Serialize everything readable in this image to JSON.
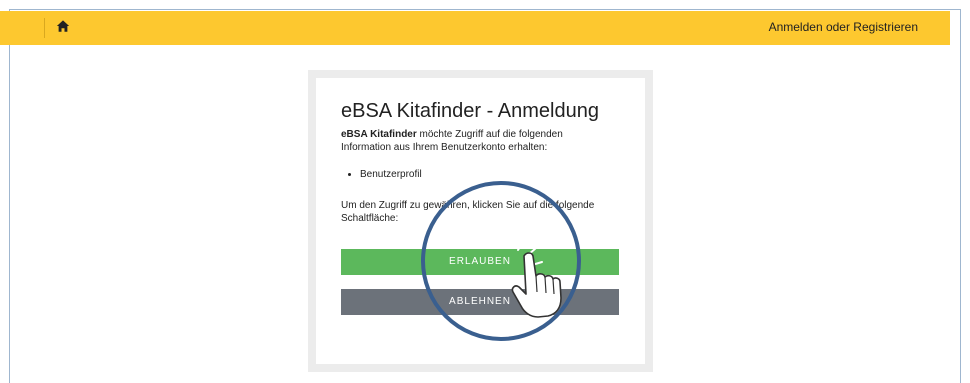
{
  "topbar": {
    "home_icon": "home-icon",
    "login_link": "Anmelden oder Registrieren",
    "color": "#fdc82f"
  },
  "consent": {
    "title": "eBSA Kitafinder - Anmeldung",
    "app_name": "eBSA Kitafinder",
    "intro_rest": " möchte Zugriff auf die folgenden Information aus Ihrem Benutzerkonto erhalten:",
    "scopes": [
      "Benutzerprofil"
    ],
    "hint": "Um den Zugriff zu gewähren, klicken Sie auf die folgende Schaltfläche:",
    "allow_label": "ERLAUBEN",
    "deny_label": "ABLEHNEN",
    "allow_color": "#5cb85c",
    "deny_color": "#6c727a"
  },
  "overlay": {
    "icon": "hand-pointer-click-icon",
    "ring_color": "#3a5f8f"
  }
}
